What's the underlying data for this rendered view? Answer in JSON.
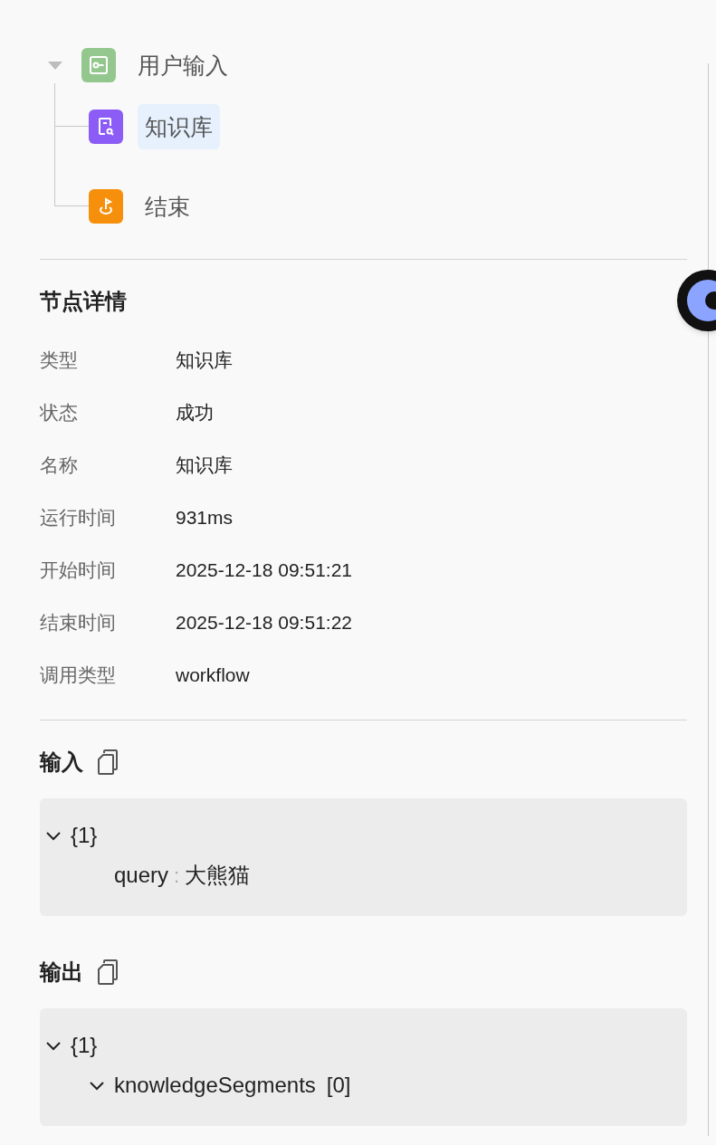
{
  "flow_tree": {
    "label": "用户输入",
    "kind": "input",
    "expanded": true,
    "selected": false,
    "children": [
      {
        "label": "知识库",
        "kind": "knowledge",
        "selected": true
      },
      {
        "label": "结束",
        "kind": "end",
        "selected": false
      }
    ]
  },
  "details": {
    "title": "节点详情",
    "rows": [
      {
        "label": "类型",
        "value": "知识库"
      },
      {
        "label": "状态",
        "value": "成功"
      },
      {
        "label": "名称",
        "value": "知识库"
      },
      {
        "label": "运行时间",
        "value": "931ms"
      },
      {
        "label": "开始时间",
        "value": "2025-12-18 09:51:21"
      },
      {
        "label": "结束时间",
        "value": "2025-12-18 09:51:22"
      },
      {
        "label": "调用类型",
        "value": "workflow"
      }
    ]
  },
  "input": {
    "title": "输入",
    "tree": {
      "summary": "{1}",
      "expanded": true,
      "children": [
        {
          "key": "query",
          "separator": ":",
          "value": "大熊猫"
        }
      ]
    }
  },
  "output": {
    "title": "输出",
    "tree": {
      "summary": "{1}",
      "expanded": true,
      "children": [
        {
          "key": "knowledgeSegments",
          "summary": "[0]",
          "expanded": true
        }
      ]
    }
  }
}
